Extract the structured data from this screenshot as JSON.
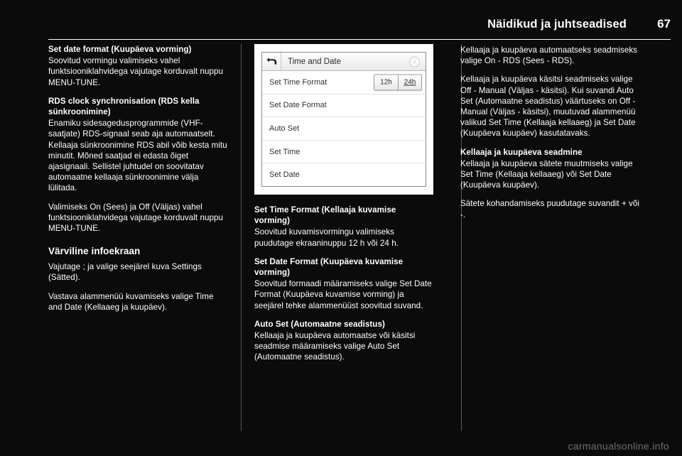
{
  "header": {
    "title": "Näidikud ja juhtseadised",
    "page_number": "67"
  },
  "column1": {
    "s1_heading": "Set date format (Kuupäeva vorming)",
    "s1_body": "Soovitud vormingu valimiseks vahel funktsiooniklahvidega vajutage korduvalt nuppu MENU-TUNE.",
    "s2_heading": "RDS clock synchronisation (RDS kella sünkroonimine)",
    "s2_body": "Enamiku sidesagedusprogrammide (VHF-saatjate) RDS-signaal seab aja automaatselt. Kellaaja sünkroonimine RDS abil võib kesta mitu minutit. Mõned saatjad ei edasta õiget ajasignaali. Sellistel juhtudel on soovitatav automaatne kellaaja sünkroonimine välja lülitada.",
    "s3_body": "Valimiseks On (Sees) ja Off (Väljas) vahel funktsiooniklahvidega vajutage korduvalt nuppu MENU-TUNE.",
    "s4_heading": "Värviline infoekraan",
    "s4_body": "Vajutage ; ja valige seejärel kuva Settings (Sätted).",
    "s5_body": "Vastava alammenüü kuvamiseks valige Time and Date (Kellaaeg ja kuupäev)."
  },
  "screenshot": {
    "back_icon": "back-arrow-icon",
    "title": "Time and Date",
    "corner_icon": "music-note-icon",
    "rows": [
      {
        "label": "Set Time Format",
        "control": "segmented"
      },
      {
        "label": "Set Date Format",
        "control": "none"
      },
      {
        "label": "Auto Set",
        "control": "none"
      },
      {
        "label": "Set Time",
        "control": "none"
      },
      {
        "label": "Set Date",
        "control": "none"
      }
    ],
    "time_format_options": [
      {
        "label": "12h",
        "selected": false
      },
      {
        "label": "24h",
        "selected": true
      }
    ]
  },
  "column2": {
    "s1_heading": "Set Time Format (Kellaaja kuvamise vorming)",
    "s1_body": "Soovitud kuvamisvormingu valimiseks puudutage ekraaninuppu 12 h või 24 h.",
    "s2_heading": "Set Date Format (Kuupäeva kuvamise vorming)",
    "s2_body": "Soovitud formaadi määramiseks valige Set Date Format (Kuupäeva kuvamise vorming) ja seejärel tehke alammenüüst soovitud suvand.",
    "s3_heading": "Auto Set (Automaatne seadistus)",
    "s3_body": "Kellaaja ja kuupäeva automaatse või käsitsi seadmise määramiseks valige Auto Set (Automaatne seadistus)."
  },
  "column3": {
    "s1_body": "Kellaaja ja kuupäeva automaatseks seadmiseks valige On - RDS (Sees - RDS).",
    "s2_body": "Kellaaja ja kuupäeva käsitsi seadmiseks valige Off - Manual (Väljas - käsitsi). Kui suvandi Auto Set (Automaatne seadistus) väärtuseks on Off - Manual (Väljas - käsitsi), muutuvad alammenüü valikud Set Time (Kellaaja kellaaeg) ja Set Date (Kuupäeva kuupäev) kasutatavaks.",
    "s3_heading": "Kellaaja ja kuupäeva seadmine",
    "s3_body": "Kellaaja ja kuupäeva sätete muutmiseks valige Set Time (Kellaaja kellaaeg) või Set Date (Kuupäeva kuupäev).",
    "s4_body": "Sätete kohandamiseks puudutage suvandit + või -."
  },
  "watermark": "carmanualsonline.info"
}
